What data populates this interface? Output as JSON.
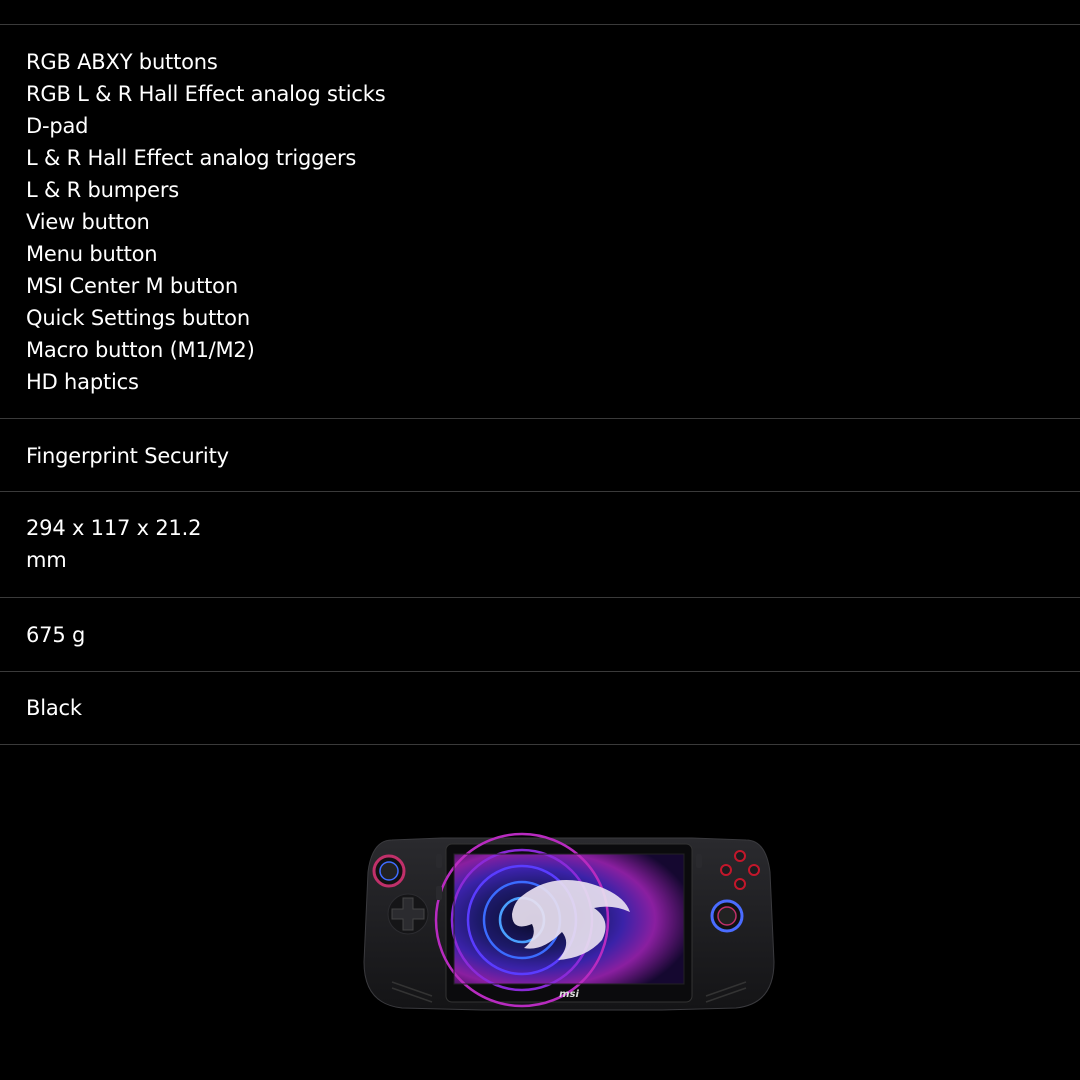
{
  "specs": {
    "controls": [
      "RGB ABXY buttons",
      "RGB L & R Hall Effect analog sticks",
      "D-pad",
      "L & R Hall Effect analog triggers",
      "L & R bumpers",
      "View button",
      "Menu button",
      "MSI Center M button",
      "Quick Settings button",
      "Macro button (M1/M2)",
      "HD haptics"
    ],
    "security": "Fingerprint Security",
    "dimensions_line1": "294 x 117 x 21.2",
    "dimensions_line2": "mm",
    "weight": "675 g",
    "color": "Black"
  },
  "device": {
    "logo": "msi",
    "body_color": "#1a1a1c",
    "ring_left_color": "#c0306a",
    "ring_right_color": "#4a6cff",
    "abxy_color": "#c3172b"
  }
}
